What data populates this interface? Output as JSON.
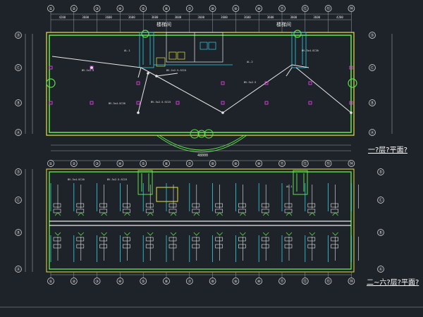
{
  "drawing": {
    "background": "#1e2229",
    "colors": {
      "axis": "#e03b3b",
      "wall": "#5fe04a",
      "outline": "#e6e63c",
      "cyan": "#2fd4e6",
      "white": "#e8e8e8",
      "magenta": "#e040e0",
      "dim": "#9aa0a8"
    }
  },
  "plan1": {
    "title": "一?层?平面?",
    "column_labels": [
      "①",
      "②",
      "③",
      "④",
      "⑤",
      "⑥",
      "⑦",
      "⑧",
      "⑨",
      "⑩",
      "⑪",
      "⑫",
      "⑬",
      "⑭"
    ],
    "row_labels": [
      "Ⓓ",
      "Ⓒ",
      "Ⓑ",
      "Ⓐ"
    ],
    "stair_labels": [
      "楼梯间",
      "楼梯间"
    ],
    "tags": [
      "AL-1",
      "AL-2",
      "BV-2x2.5",
      "BV-3x2.5",
      "BV-3x4-SC20",
      "BV-3x2.5-SC15",
      "BV-2x2.5-SC15",
      "BV-3x4-SC20"
    ]
  },
  "plan2": {
    "title": "二~六?层?平面?",
    "column_labels": [
      "①",
      "②",
      "③",
      "④",
      "⑤",
      "⑥",
      "⑦",
      "⑧",
      "⑨",
      "⑩",
      "⑪",
      "⑫",
      "⑬",
      "⑭"
    ],
    "row_labels": [
      "Ⓓ",
      "Ⓒ",
      "Ⓑ",
      "Ⓐ"
    ],
    "tags": [
      "BV-3x4-SC20",
      "BV-3x2.5-SC15",
      "AL-1"
    ]
  },
  "dimensions": {
    "top": [
      "4200",
      "3600",
      "3600",
      "3600",
      "3600",
      "3600",
      "3600",
      "3600",
      "3600",
      "3600",
      "3600",
      "3600",
      "4200"
    ],
    "total": "48000"
  }
}
